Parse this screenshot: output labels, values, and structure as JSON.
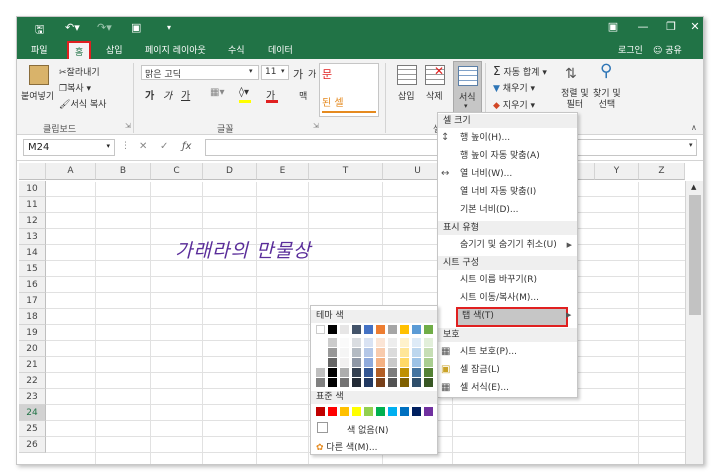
{
  "ribbon_tabs": [
    "파일",
    "홈",
    "삽입",
    "페이지 레이아웃",
    "수식",
    "데이터"
  ],
  "active_tab": "홈",
  "account": {
    "login": "로그인",
    "share": "공유"
  },
  "clipboard": {
    "paste": "붙여넣기",
    "cut": "잘라내기",
    "copy": "복사",
    "format_painter": "서식 복사",
    "group": "클립보드"
  },
  "font": {
    "name": "맑은 고딕",
    "size": "11",
    "group": "글꼴",
    "bold": "가",
    "italic": "가",
    "underline": "가",
    "fontcolor": "가",
    "grow": "가",
    "shrink": "가",
    "style_red": "문",
    "style_merge": "된 셀",
    "style_wrap": "맥",
    "group_short": "셀"
  },
  "cells": {
    "insert": "삽입",
    "delete": "삭제",
    "format": "서식",
    "group": "셀"
  },
  "editing": {
    "autosum": "자동 합계",
    "fill": "채우기",
    "clear": "지우기",
    "sort_filter": "정렬 및\n필터",
    "find_select": "찾기 및\n선택"
  },
  "namebox": "M24",
  "columns": [
    "A",
    "B",
    "C",
    "D",
    "E",
    "T",
    "U",
    "Y",
    "Z"
  ],
  "rows": [
    "10",
    "11",
    "12",
    "13",
    "14",
    "15",
    "16",
    "17",
    "18",
    "19",
    "20",
    "21",
    "22",
    "23",
    "24",
    "25",
    "26"
  ],
  "current_row": "24",
  "handwriting": "가래라의 만물상",
  "format_menu": {
    "sections": [
      {
        "title": "셀 크기",
        "items": [
          "행 높이(H)...",
          "행 높이 자동 맞춤(A)",
          "열 너비(W)...",
          "열 너비 자동 맞춤(I)",
          "기본 너비(D)..."
        ]
      },
      {
        "title": "표시 유형",
        "items": [
          "숨기기 및 숨기기 취소(U)"
        ]
      },
      {
        "title": "시트 구성",
        "items": [
          "시트 이름 바꾸기(R)",
          "시트 이동/복사(M)...",
          "탭 색(T)"
        ]
      },
      {
        "title": "보호",
        "items": [
          "시트 보호(P)...",
          "셀 잠금(L)",
          "셀 서식(E)..."
        ]
      }
    ]
  },
  "palette": {
    "theme_title": "테마 색",
    "standard_title": "표준 색",
    "no_color": "색 없음(N)",
    "more_colors": "다른 색(M)...",
    "theme_colors": [
      "#ffffff",
      "#000000",
      "#e7e6e6",
      "#44546a",
      "#4472c4",
      "#ed7d31",
      "#a5a5a5",
      "#ffc000",
      "#5b9bd5",
      "#70ad47"
    ],
    "standard_colors": [
      "#c00000",
      "#ff0000",
      "#ffc000",
      "#ffff00",
      "#92d050",
      "#00b050",
      "#00b0f0",
      "#0070c0",
      "#002060",
      "#7030a0"
    ]
  }
}
